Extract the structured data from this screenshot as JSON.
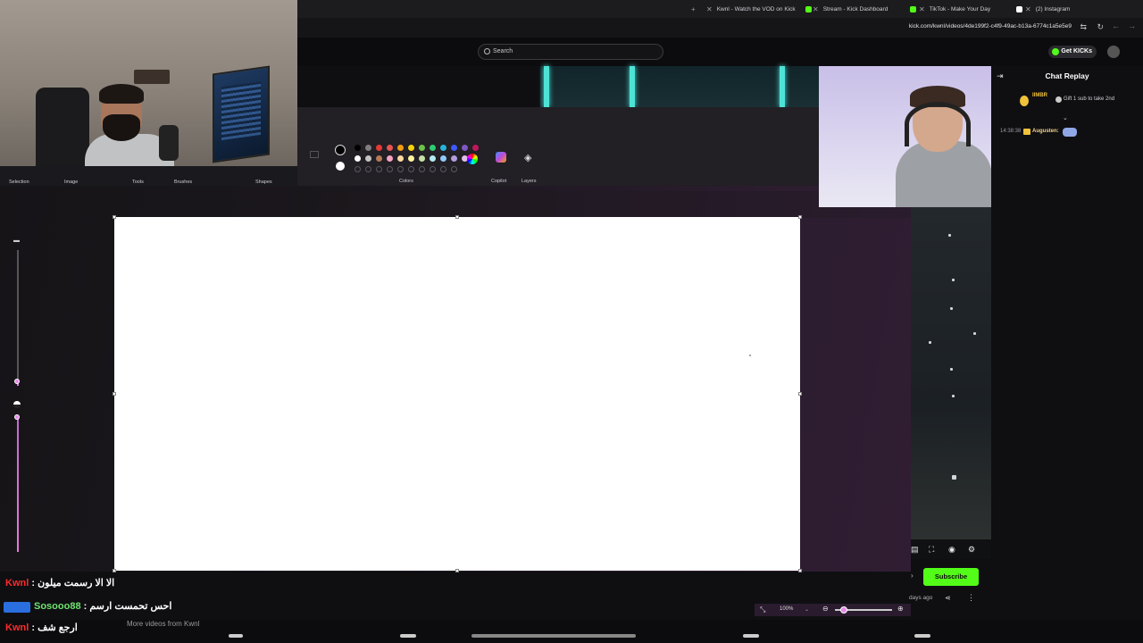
{
  "browser": {
    "tabs": [
      {
        "label": "Kwnl - Watch the VOD on Kick"
      },
      {
        "label": "Stream - Kick Dashboard"
      },
      {
        "label": "TikTok - Make Your Day"
      },
      {
        "label": "(2) Instagram"
      }
    ],
    "url": "kick.com/kwnl/videos/4de199f2-c4f9-49ac-b13a-6774c1a5e5e9"
  },
  "kick": {
    "search_placeholder": "Search",
    "get_kicks": "Get KICKs",
    "subscribe": "Subscribe",
    "days_ago": "days ago",
    "more_videos": "More videos from Kwnl"
  },
  "paint": {
    "groups": {
      "selection": "Selection",
      "image": "Image",
      "tools": "Tools",
      "brushes": "Brushes",
      "shapes": "Shapes",
      "colors": "Colors",
      "copilot": "Copilot",
      "layers": "Layers"
    },
    "zoom": "100%",
    "palette_row1": [
      "#000000",
      "#7f7f7f",
      "#e53935",
      "#e8554e",
      "#f39c12",
      "#f5d20b",
      "#6cc24a",
      "#2ecc71",
      "#26b5d9",
      "#3d5afe",
      "#7e57c2",
      "#c2185b"
    ],
    "palette_row2": [
      "#ffffff",
      "#c3c3c3",
      "#b77a57",
      "#f8a5c2",
      "#fdd9a0",
      "#fff59d",
      "#c5e1a5",
      "#b2ebf2",
      "#90caf9",
      "#b39ddb",
      "#e1bee7"
    ]
  },
  "chat": {
    "title": "Chat Replay",
    "gift_user": "IIMBR",
    "gift_text": "Gift 1 sub to take 2nd",
    "line1_time": "14:38:38",
    "line1_user": "Augusten:"
  },
  "overlay_chat": [
    {
      "user": "Kwnl",
      "sep": " : ",
      "message": "الا الا رسمت ميلون"
    },
    {
      "user": "Sosooo88",
      "sep": " : ",
      "message": "احس تحمست ارسم"
    },
    {
      "user": "Kwnl",
      "sep": " : ",
      "message": "ارجع شف"
    }
  ]
}
